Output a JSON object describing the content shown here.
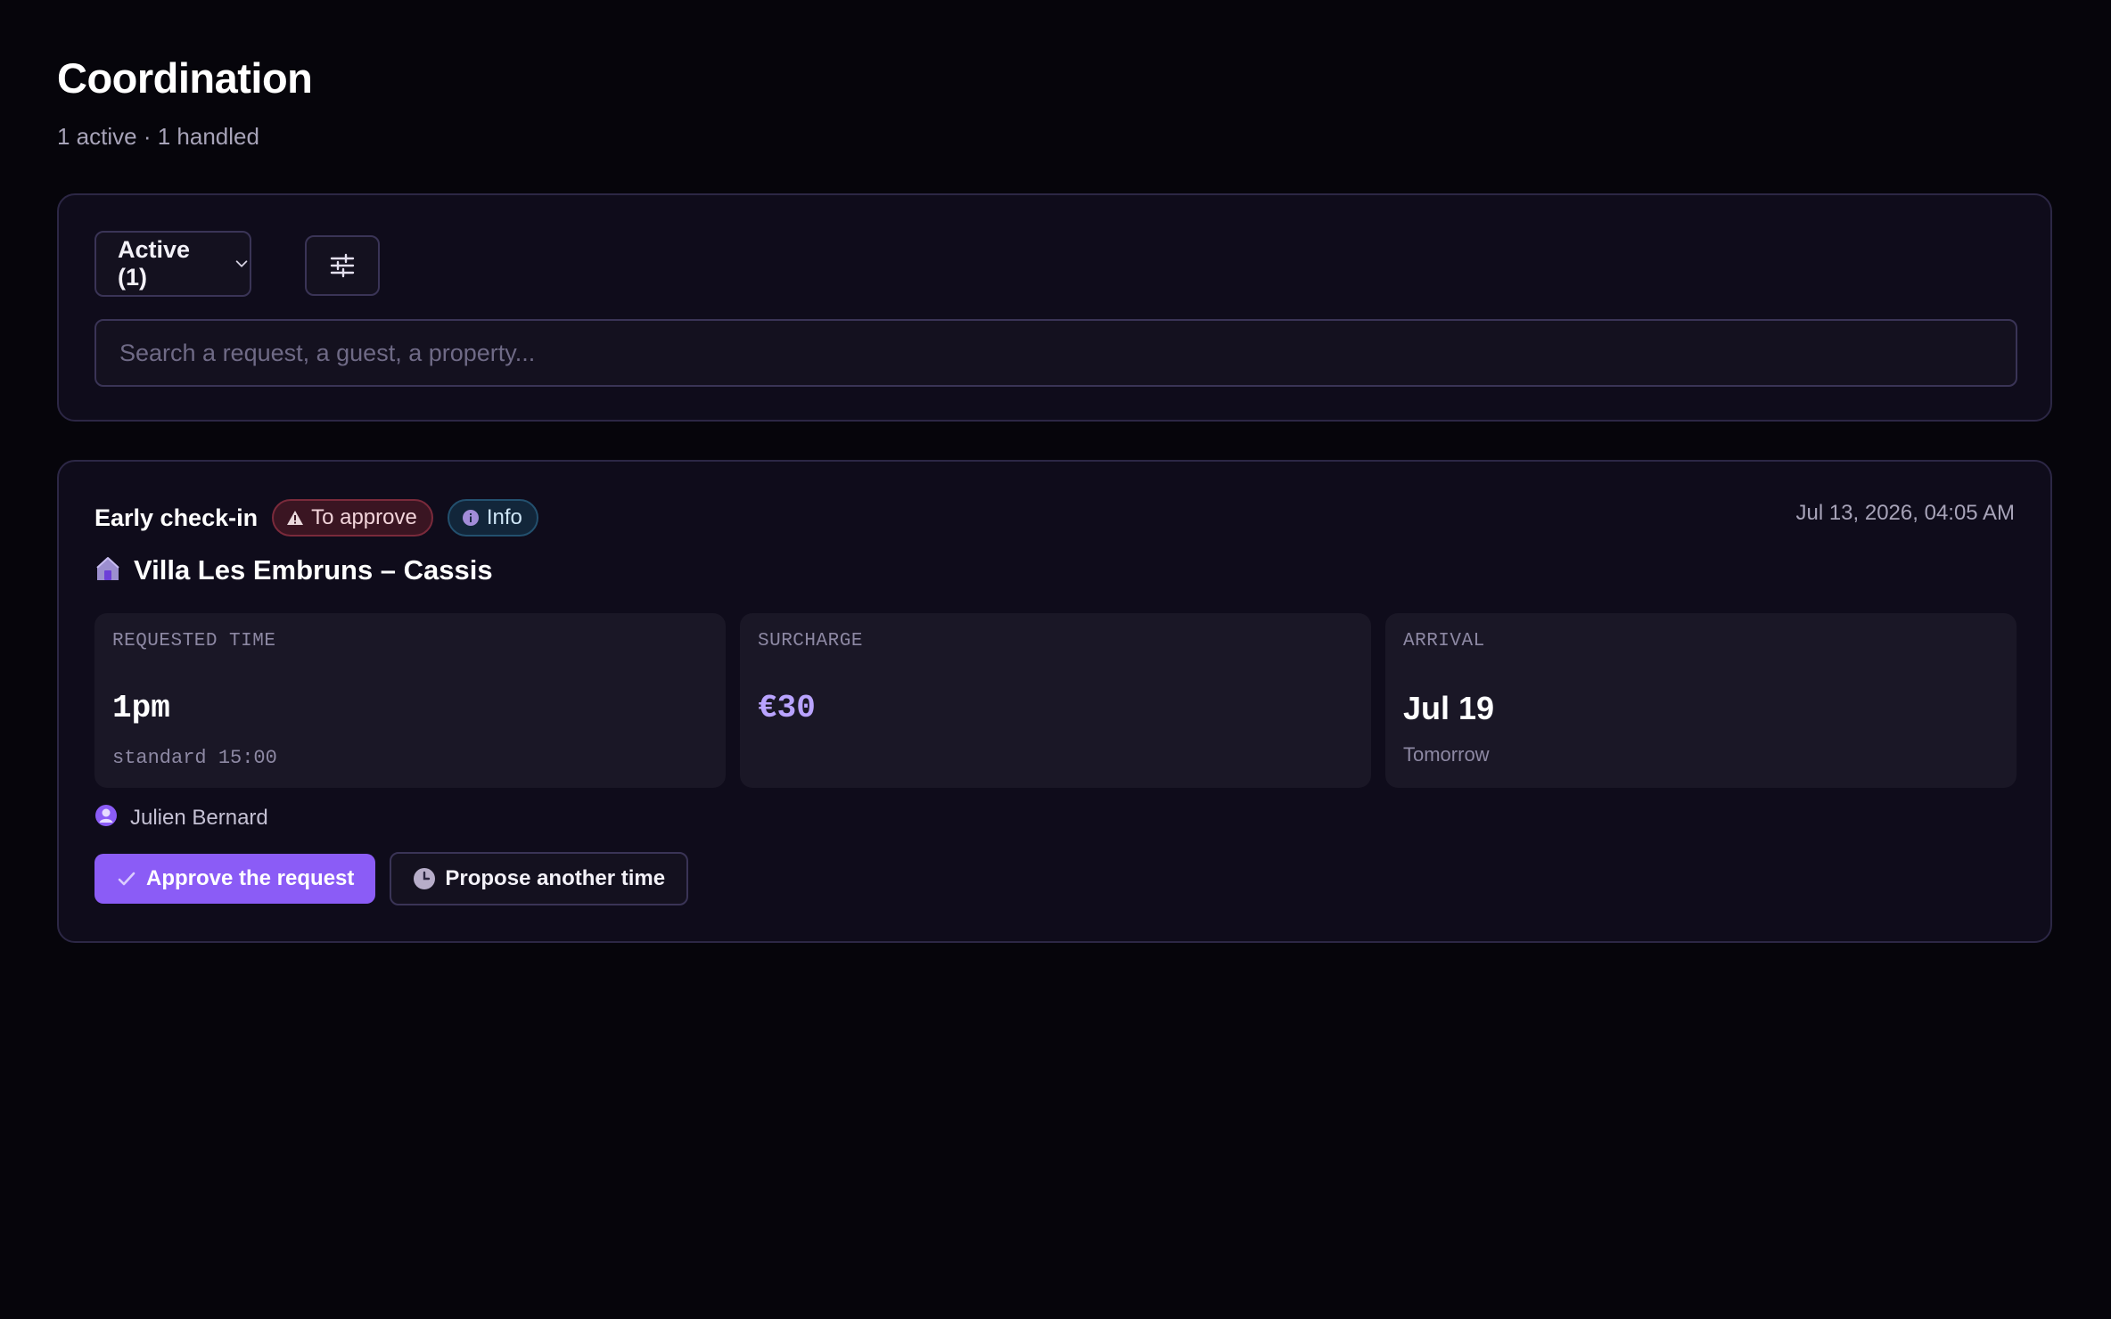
{
  "header": {
    "title": "Coordination",
    "subtitle": "1 active · 1 handled"
  },
  "filters": {
    "status_dropdown": {
      "selected": "Active (1)",
      "icon": "chevron-down-icon"
    },
    "filter_button": {
      "icon": "sliders-icon"
    },
    "search": {
      "placeholder": "Search a request, a guest, a property...",
      "value": ""
    }
  },
  "requests": [
    {
      "type": "Early check-in",
      "badges": [
        {
          "label": "To approve",
          "icon": "warning-icon",
          "color": "#7a2a3b"
        },
        {
          "label": "Info",
          "icon": "info-icon",
          "color": "#23506e"
        }
      ],
      "timestamp": "Jul 13, 2026, 04:05 AM",
      "property": {
        "name": "Villa Les Embruns – Cassis",
        "icon": "house-icon"
      },
      "stats": [
        {
          "label": "REQUESTED TIME",
          "value": "1pm",
          "sub": "standard 15:00"
        },
        {
          "label": "SURCHARGE",
          "value": "€30",
          "sub": ""
        },
        {
          "label": "ARRIVAL",
          "value": "Jul 19",
          "sub": "Tomorrow"
        }
      ],
      "guest": {
        "name": "Julien Bernard",
        "icon": "user-icon"
      },
      "actions": {
        "approve": {
          "label": "Approve the request",
          "icon": "check-icon"
        },
        "propose": {
          "label": "Propose another time",
          "icon": "clock-icon"
        }
      }
    }
  ],
  "colors": {
    "background": "#06050b",
    "panel": "#0f0c1b",
    "accent": "#8b5cf6",
    "accent_text": "#b9a3ff"
  }
}
